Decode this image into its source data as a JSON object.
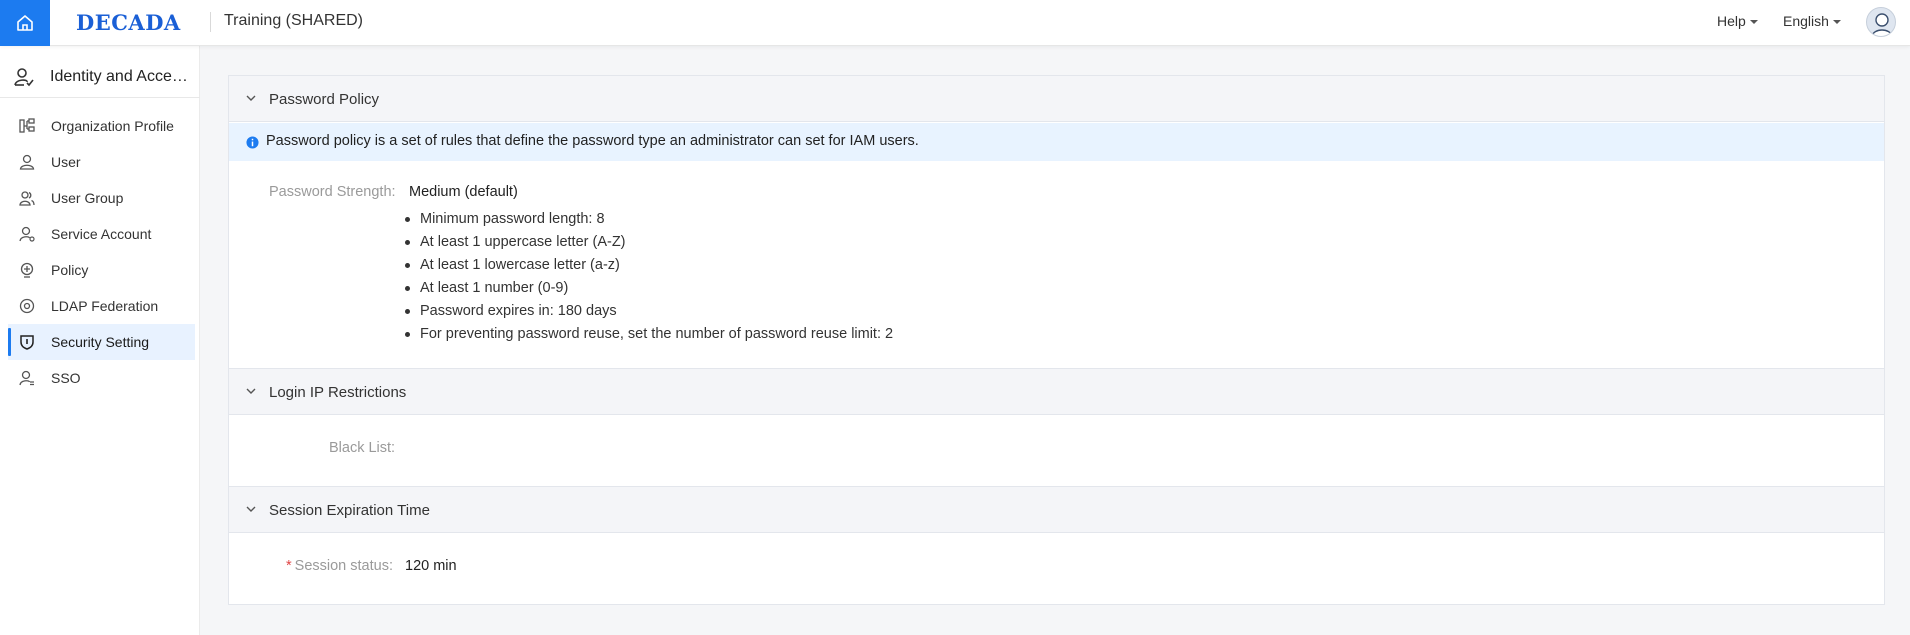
{
  "header": {
    "logo": "DECADA",
    "workspace": "Training (SHARED)",
    "help_label": "Help",
    "language_label": "English"
  },
  "sidebar": {
    "title": "Identity and Access Management",
    "items": [
      {
        "label": "Organization Profile",
        "icon": "org-chart-icon"
      },
      {
        "label": "User",
        "icon": "user-icon"
      },
      {
        "label": "User Group",
        "icon": "user-group-icon"
      },
      {
        "label": "Service Account",
        "icon": "service-account-icon"
      },
      {
        "label": "Policy",
        "icon": "policy-icon"
      },
      {
        "label": "LDAP Federation",
        "icon": "ldap-icon"
      },
      {
        "label": "Security Setting",
        "icon": "shield-icon",
        "active": true
      },
      {
        "label": "SSO",
        "icon": "sso-icon"
      }
    ]
  },
  "password_policy": {
    "title": "Password Policy",
    "notice": "Password policy is a set of rules that define the password type an administrator can set for IAM users.",
    "strength_label": "Password Strength:",
    "strength_value": "Medium (default)",
    "rules": [
      "Minimum password length: 8",
      "At least 1 uppercase letter (A-Z)",
      "At least 1 lowercase letter (a-z)",
      "At least 1 number (0-9)",
      "Password expires in: 180 days",
      "For preventing password reuse, set the number of password reuse limit: 2"
    ]
  },
  "login_ip": {
    "title": "Login IP Restrictions",
    "blacklist_label": "Black List:",
    "blacklist_value": ""
  },
  "session": {
    "title": "Session Expiration Time",
    "required_mark": "*",
    "status_label": "Session status:",
    "status_value": "120 min"
  },
  "colors": {
    "primary": "#1c7bf0",
    "notice_bg": "#e8f3ff",
    "active_nav_bg": "#e8f2ff",
    "section_header_bg": "#f4f5f8",
    "required": "#e04545"
  }
}
